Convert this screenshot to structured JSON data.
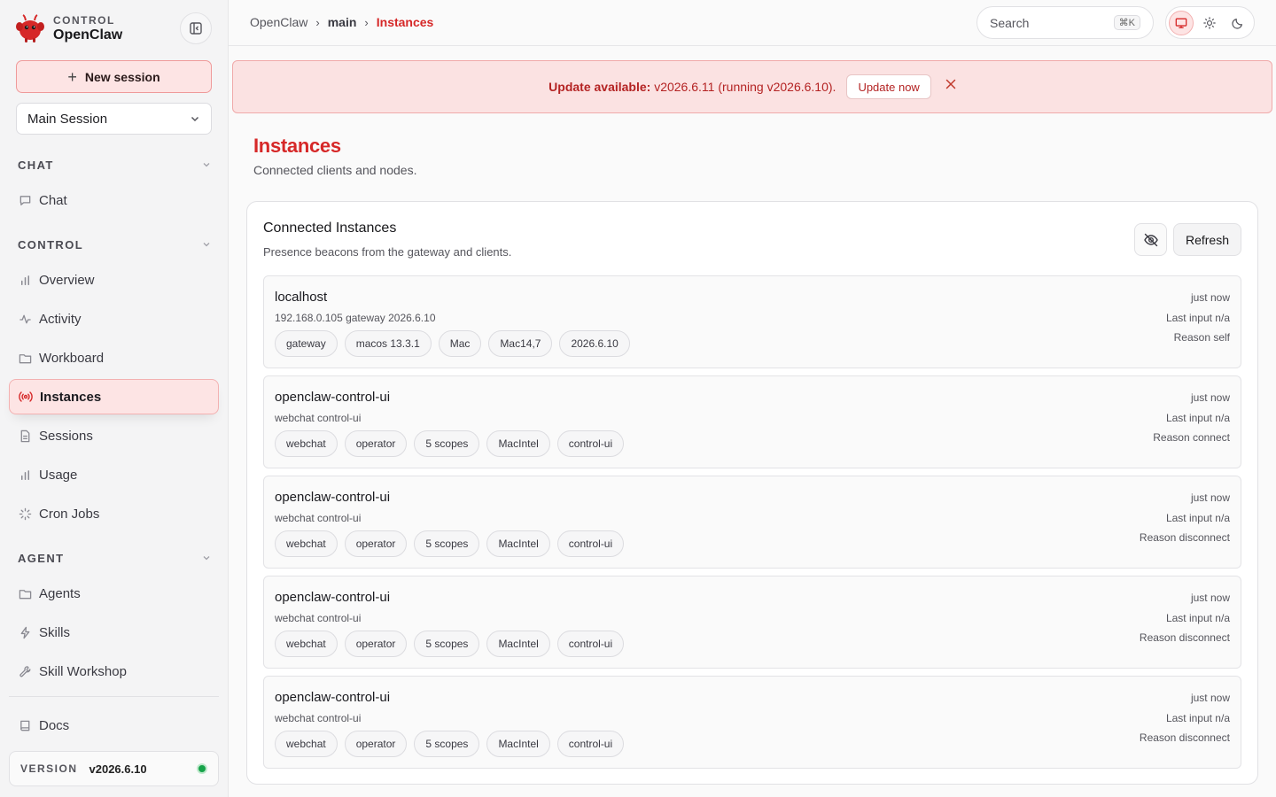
{
  "brand": {
    "kicker": "CONTROL",
    "name": "OpenClaw",
    "logo_color": "#d62828"
  },
  "sidebar": {
    "new_session_label": "New session",
    "session_select_value": "Main Session",
    "sections": {
      "chat": "CHAT",
      "control": "CONTROL",
      "agent": "AGENT"
    },
    "items": {
      "chat": "Chat",
      "overview": "Overview",
      "activity": "Activity",
      "workboard": "Workboard",
      "instances": "Instances",
      "sessions": "Sessions",
      "usage": "Usage",
      "cron_jobs": "Cron Jobs",
      "agents": "Agents",
      "skills": "Skills",
      "skill_workshop": "Skill Workshop",
      "docs": "Docs"
    },
    "version_label": "VERSION",
    "version_value": "v2026.6.10",
    "status_color": "#16a34a"
  },
  "topbar": {
    "breadcrumb": [
      "OpenClaw",
      "main",
      "Instances"
    ],
    "search_placeholder": "Search",
    "search_shortcut": "⌘K"
  },
  "banner": {
    "label": "Update available:",
    "message": "v2026.6.11 (running v2026.6.10).",
    "button": "Update now"
  },
  "page": {
    "title": "Instances",
    "subtitle": "Connected clients and nodes.",
    "accent": "#d62828"
  },
  "card": {
    "title": "Connected Instances",
    "subtitle": "Presence beacons from the gateway and clients.",
    "refresh_label": "Refresh",
    "instances": [
      {
        "name": "localhost",
        "sub": "192.168.0.105 gateway 2026.6.10",
        "chips": [
          "gateway",
          "macos 13.3.1",
          "Mac",
          "Mac14,7",
          "2026.6.10"
        ],
        "time": "just now",
        "last_input": "Last input n/a",
        "reason": "Reason self"
      },
      {
        "name": "openclaw-control-ui",
        "sub": "webchat control-ui",
        "chips": [
          "webchat",
          "operator",
          "5 scopes",
          "MacIntel",
          "control-ui"
        ],
        "time": "just now",
        "last_input": "Last input n/a",
        "reason": "Reason connect"
      },
      {
        "name": "openclaw-control-ui",
        "sub": "webchat control-ui",
        "chips": [
          "webchat",
          "operator",
          "5 scopes",
          "MacIntel",
          "control-ui"
        ],
        "time": "just now",
        "last_input": "Last input n/a",
        "reason": "Reason disconnect"
      },
      {
        "name": "openclaw-control-ui",
        "sub": "webchat control-ui",
        "chips": [
          "webchat",
          "operator",
          "5 scopes",
          "MacIntel",
          "control-ui"
        ],
        "time": "just now",
        "last_input": "Last input n/a",
        "reason": "Reason disconnect"
      },
      {
        "name": "openclaw-control-ui",
        "sub": "webchat control-ui",
        "chips": [
          "webchat",
          "operator",
          "5 scopes",
          "MacIntel",
          "control-ui"
        ],
        "time": "just now",
        "last_input": "Last input n/a",
        "reason": "Reason disconnect"
      }
    ]
  }
}
